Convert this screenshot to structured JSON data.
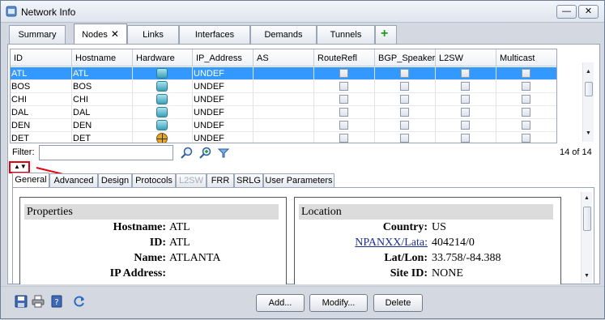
{
  "window": {
    "title": "Network Info",
    "minimize_label": "—",
    "restore_label": "▭",
    "close_label": "✕"
  },
  "main_tabs": [
    {
      "label": "Summary"
    },
    {
      "label": "Nodes",
      "close": "✕",
      "active": true
    },
    {
      "label": "Links"
    },
    {
      "label": "Interfaces"
    },
    {
      "label": "Demands"
    },
    {
      "label": "Tunnels"
    }
  ],
  "add_tab_label": "+",
  "table": {
    "columns": [
      "ID",
      "Hostname",
      "Hardware",
      "IP_Address",
      "AS",
      "RouteRefl",
      "BGP_Speaker",
      "L2SW",
      "Multicast"
    ],
    "rows": [
      {
        "id": "ATL",
        "hostname": "ATL",
        "hw": "router",
        "ip": "UNDEF",
        "selected": true
      },
      {
        "id": "BOS",
        "hostname": "BOS",
        "hw": "router",
        "ip": "UNDEF"
      },
      {
        "id": "CHI",
        "hostname": "CHI",
        "hw": "router",
        "ip": "UNDEF"
      },
      {
        "id": "DAL",
        "hostname": "DAL",
        "hw": "router",
        "ip": "UNDEF"
      },
      {
        "id": "DEN",
        "hostname": "DEN",
        "hw": "router",
        "ip": "UNDEF"
      },
      {
        "id": "DET",
        "hostname": "DET",
        "hw": "crosshair",
        "ip": "UNDEF"
      }
    ]
  },
  "filter": {
    "label": "Filter:",
    "value": "",
    "count": "14 of 14"
  },
  "icons": {
    "search": "search-icon",
    "zoom": "zoom-icon",
    "filter_options": "filter-options-icon"
  },
  "detail_tabs": [
    {
      "label": "General",
      "active": true
    },
    {
      "label": "Advanced"
    },
    {
      "label": "Design"
    },
    {
      "label": "Protocols"
    },
    {
      "label": "L2SW",
      "disabled": true
    },
    {
      "label": "FRR"
    },
    {
      "label": "SRLG"
    },
    {
      "label": "User Parameters"
    }
  ],
  "properties": {
    "heading": "Properties",
    "fields": [
      {
        "label": "Hostname:",
        "value": "ATL"
      },
      {
        "label": "ID:",
        "value": "ATL"
      },
      {
        "label": "Name:",
        "value": "ATLANTA"
      },
      {
        "label": "IP Address:",
        "value": ""
      }
    ]
  },
  "location": {
    "heading": "Location",
    "fields": [
      {
        "label": "Country:",
        "value": "US"
      },
      {
        "label": "NPANXX/Lata:",
        "value": "404214/0",
        "link": true
      },
      {
        "label": "Lat/Lon:",
        "value": "33.758/-84.388"
      },
      {
        "label": "Site ID:",
        "value": "NONE"
      }
    ]
  },
  "buttons": {
    "add": "Add...",
    "modify": "Modify...",
    "delete": "Delete"
  },
  "colors": {
    "selection": "#3399ff",
    "annotation": "#e8000f",
    "add_tab": "#1e9b1e"
  }
}
